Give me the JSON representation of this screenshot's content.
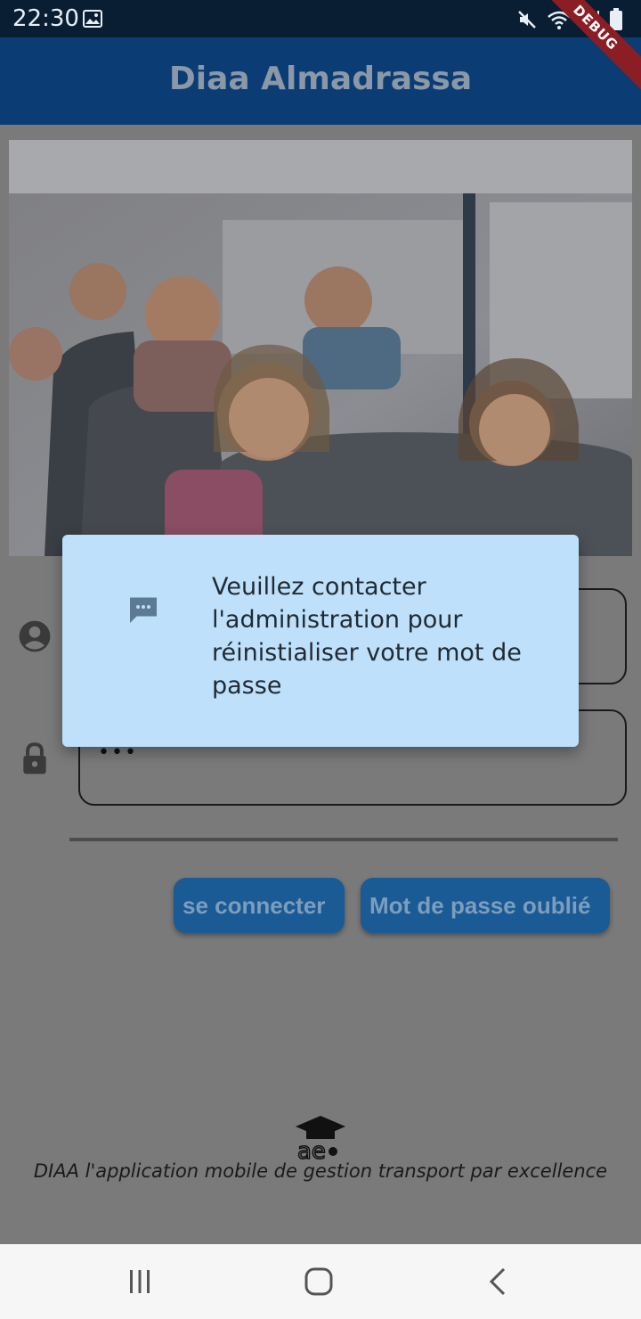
{
  "status_bar": {
    "time": "22:30",
    "icons": [
      "gallery-icon",
      "mute-icon",
      "wifi-icon",
      "signal-icon",
      "battery-icon"
    ]
  },
  "app_bar": {
    "title": "Diaa Almadrassa",
    "debug_banner": "DEBUG"
  },
  "login": {
    "username_value": "",
    "password_value": "•••",
    "icons": [
      "account-circle-icon",
      "lock-icon"
    ]
  },
  "buttons": {
    "login_label": "se connecter",
    "forgot_label": "Mot de passe oublié"
  },
  "footer": {
    "tagline": "DIAA l'application mobile de gestion transport par excellence"
  },
  "dialog": {
    "icon": "message-icon",
    "message": "Veuillez contacter l'administration pour réinistialiser votre mot de passe"
  },
  "nav_bar": {
    "buttons": [
      "recent-apps",
      "home",
      "back"
    ]
  },
  "colors": {
    "app_bar": "#0b3d74",
    "status_bar": "#0a1e33",
    "dialog_bg": "#bfe0fa",
    "button_bg": "#1a5a95",
    "scrim": "#7a7a7a"
  }
}
